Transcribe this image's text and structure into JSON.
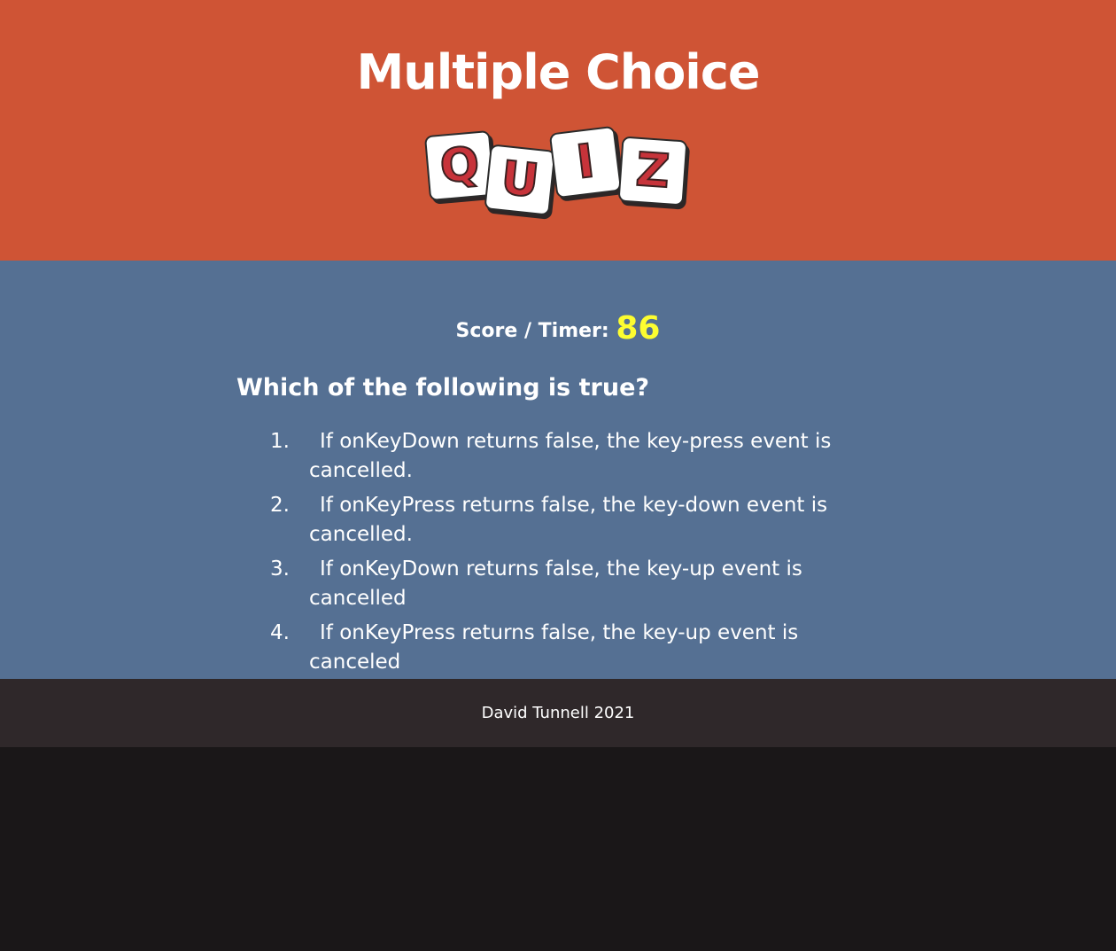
{
  "header": {
    "title": "Multiple Choice",
    "logo_letters": [
      "Q",
      "U",
      "I",
      "Z"
    ]
  },
  "score": {
    "label": "Score / Timer:",
    "value": "86"
  },
  "question": {
    "text": "Which of the following is true?",
    "choices": [
      {
        "number": "1.",
        "text": "If onKeyDown returns false, the key-press event is cancelled."
      },
      {
        "number": "2.",
        "text": "If onKeyPress returns false, the key-down event is cancelled."
      },
      {
        "number": "3.",
        "text": "If onKeyDown returns false, the key-up event is cancelled"
      },
      {
        "number": "4.",
        "text": "If onKeyPress returns false, the key-up event is canceled"
      }
    ]
  },
  "footer": {
    "text": "David Tunnell 2021"
  },
  "colors": {
    "header_bg": "#cf5435",
    "main_bg": "#557093",
    "footer_bg": "#2f282a",
    "page_bg": "#1a1718",
    "timer": "#fdfd30",
    "tile_letter": "#c7333a"
  }
}
